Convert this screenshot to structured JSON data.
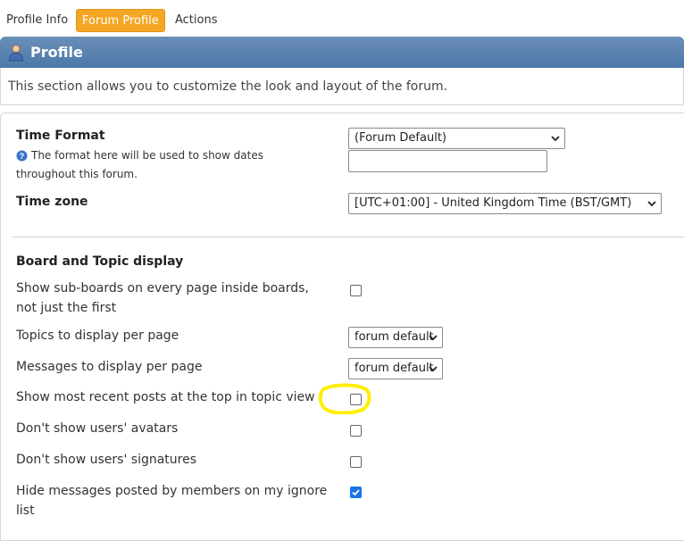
{
  "tabs": [
    {
      "label": "Profile Info"
    },
    {
      "label": "Forum Profile",
      "active": true
    },
    {
      "label": "Actions"
    }
  ],
  "header": {
    "title": "Profile"
  },
  "description": "This section allows you to customize the look and layout of the forum.",
  "time_format": {
    "label": "Time Format",
    "help_line1": "The format here will be used to show dates",
    "help_line2": "throughout this forum.",
    "select_value": "(Forum Default)",
    "custom_value": ""
  },
  "time_zone": {
    "label": "Time zone",
    "select_value": "[UTC+01:00] - United Kingdom Time (BST/GMT)"
  },
  "board_section": {
    "title": "Board and Topic display"
  },
  "options": [
    {
      "label_line1": "Show sub-boards on every page inside boards,",
      "label_line2": "not just the first",
      "type": "checkbox",
      "checked": false
    },
    {
      "label_line1": "Topics to display per page",
      "type": "select",
      "value": "forum default"
    },
    {
      "label_line1": "Messages to display per page",
      "type": "select",
      "value": "forum default"
    },
    {
      "label_line1": "Show most recent posts at the top in topic view",
      "type": "checkbox",
      "checked": false,
      "highlighted": true
    },
    {
      "label_line1": "Don't show users' avatars",
      "type": "checkbox",
      "checked": false
    },
    {
      "label_line1": "Don't show users' signatures",
      "type": "checkbox",
      "checked": false
    },
    {
      "label_line1": "Hide messages posted by members on my ignore",
      "label_line2": "list",
      "type": "checkbox",
      "checked": true
    }
  ],
  "colors": {
    "accent": "#f5a623",
    "header": "#4d78a8",
    "highlight": "#ffee00",
    "checkbox_checked": "#1a73e8"
  },
  "icons": [
    "user-icon",
    "help-icon",
    "chevron-down-icon"
  ]
}
